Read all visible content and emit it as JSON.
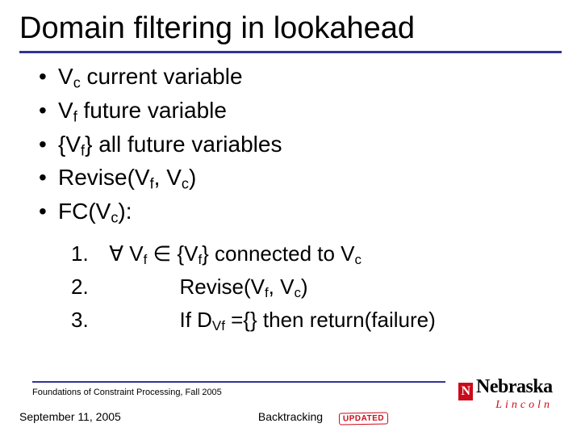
{
  "title": "Domain filtering in lookahead",
  "bullets": [
    {
      "pre": "V",
      "sub": "c",
      "post": " current variable"
    },
    {
      "pre": "V",
      "sub": "f",
      "post": " future variable"
    },
    {
      "pre": "{V",
      "sub": "f",
      "post": "} all future variables"
    },
    {
      "pre": "Revise(V",
      "sub": "f",
      "post_mid": ", V",
      "sub2": "c",
      "post": ")"
    },
    {
      "pre": "FC(V",
      "sub": "c",
      "post": "):"
    }
  ],
  "steps": {
    "s1": {
      "num": "1.",
      "forall": "∀",
      "a": " V",
      "a_sub": "f",
      "b": " ∈ {V",
      "b_sub": "f",
      "c": "} connected to V",
      "c_sub": "c"
    },
    "s2": {
      "num": "2.",
      "a": "Revise(V",
      "a_sub": "f",
      "b": ", V",
      "b_sub": "c",
      "c": ")"
    },
    "s3": {
      "num": "3.",
      "a": "If D",
      "a_sub": "Vf",
      "b": " ={} then return(failure)"
    }
  },
  "footer": {
    "course": "Foundations of Constraint Processing, Fall 2005",
    "date": "September 11, 2005",
    "center": "Backtracking"
  },
  "logo": {
    "n": "N",
    "main": "Nebraska",
    "sub": "Lincoln"
  },
  "stamp": "UPDATED"
}
